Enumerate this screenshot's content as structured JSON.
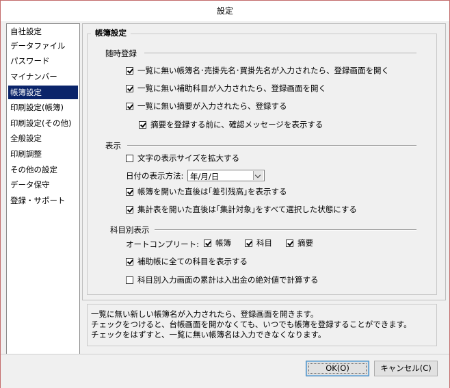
{
  "window": {
    "title": "設定"
  },
  "sidebar": {
    "items": [
      {
        "label": "自社設定"
      },
      {
        "label": "データファイル"
      },
      {
        "label": "パスワード"
      },
      {
        "label": "マイナンバー"
      },
      {
        "label": "帳簿設定",
        "selected": true
      },
      {
        "label": "印刷設定(帳簿)"
      },
      {
        "label": "印刷設定(その他)"
      },
      {
        "label": "全般設定"
      },
      {
        "label": "印刷調整"
      },
      {
        "label": "その他の設定"
      },
      {
        "label": "データ保守"
      },
      {
        "label": "登録・サポート"
      }
    ]
  },
  "panel": {
    "title": "帳簿設定",
    "auto_register": {
      "label": "随時登録",
      "items": [
        {
          "label": "一覧に無い帳簿名･売掛先名･買掛先名が入力されたら、登録画面を開く",
          "checked": true
        },
        {
          "label": "一覧に無い補助科目が入力されたら、登録画面を開く",
          "checked": true
        },
        {
          "label": "一覧に無い摘要が入力されたら、登録する",
          "checked": true
        },
        {
          "label": "摘要を登録する前に、確認メッセージを表示する",
          "checked": true
        }
      ]
    },
    "display": {
      "label": "表示",
      "enlarge_text": {
        "label": "文字の表示サイズを拡大する",
        "checked": false
      },
      "date_format_label": "日付の表示方法:",
      "date_format_value": "年/月/日",
      "show_balance": {
        "label": "帳簿を開いた直後は｢差引残高｣を表示する",
        "checked": true
      },
      "select_all": {
        "label": "集計表を開いた直後は｢集計対象｣をすべて選択した状態にする",
        "checked": true
      }
    },
    "by_account": {
      "label": "科目別表示",
      "autocomplete_label": "オートコンプリート:",
      "autocomplete": [
        {
          "label": "帳簿",
          "checked": true
        },
        {
          "label": "科目",
          "checked": true
        },
        {
          "label": "摘要",
          "checked": true
        }
      ],
      "show_all_accounts": {
        "label": "補助帳に全ての科目を表示する",
        "checked": true
      },
      "absolute_total": {
        "label": "科目別入力画面の累計は入出金の絶対値で計算する",
        "checked": false
      }
    }
  },
  "description": {
    "lines": [
      "一覧に無い新しい帳簿名が入力されたら、登録画面を開きます。",
      "チェックをつけると、台帳画面を開かなくても、いつでも帳簿を登録することができます。",
      "チェックをはずすと、一覧に無い帳簿名は入力できなくなります。"
    ]
  },
  "buttons": {
    "ok": "OK(O)",
    "cancel": "キャンセル(C)"
  }
}
